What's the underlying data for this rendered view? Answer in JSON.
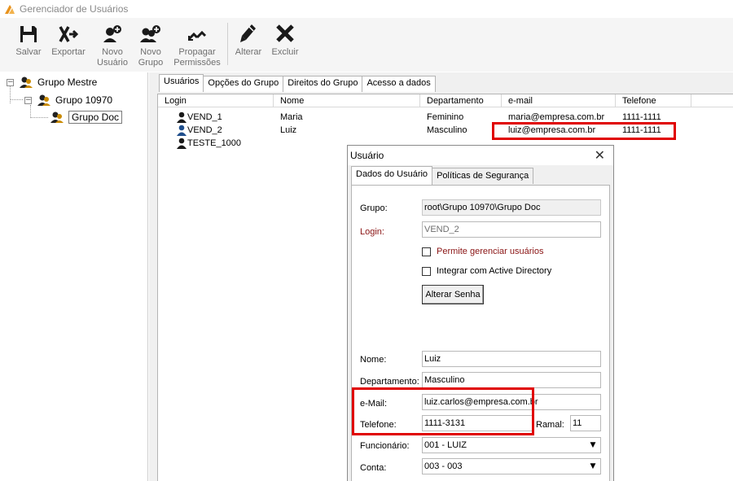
{
  "window": {
    "title": "Gerenciador de Usuários"
  },
  "toolbar": {
    "items": [
      {
        "label": "Salvar",
        "icon": "save-icon"
      },
      {
        "label": "Exportar",
        "icon": "export-icon"
      },
      {
        "label": "Novo\nUsuário",
        "icon": "new-user-icon"
      },
      {
        "label": "Novo\nGrupo",
        "icon": "new-group-icon"
      },
      {
        "label": "Propagar\nPermissões",
        "icon": "propagate-icon"
      },
      {
        "label": "Alterar",
        "icon": "edit-pencil-icon"
      },
      {
        "label": "Excluir",
        "icon": "delete-x-icon"
      }
    ]
  },
  "tree": {
    "nodes": [
      {
        "label": "Grupo Mestre",
        "expander": "−"
      },
      {
        "label": "Grupo 10970",
        "expander": "−"
      },
      {
        "label": "Grupo Doc"
      }
    ]
  },
  "tabs": [
    "Usuários",
    "Opções do Grupo",
    "Direitos do Grupo",
    "Acesso a dados"
  ],
  "list": {
    "columns": [
      "Login",
      "Nome",
      "Departamento",
      "e-mail",
      "Telefone"
    ],
    "rows": [
      {
        "login": "VEND_1",
        "nome": "Maria",
        "departamento": "Feminino",
        "email": "maria@empresa.com.br",
        "telefone": "1111-1111",
        "icon_color": "#1a1a1a"
      },
      {
        "login": "VEND_2",
        "nome": "Luiz",
        "departamento": "Masculino",
        "email": "luiz@empresa.com.br",
        "telefone": "1111-1111",
        "icon_color": "#1f4e8c"
      },
      {
        "login": "TESTE_1000",
        "nome": "",
        "departamento": "",
        "email": "",
        "telefone": "",
        "icon_color": "#1a1a1a"
      }
    ]
  },
  "dialog": {
    "title": "Usuário",
    "close": "✕",
    "tabs": [
      "Dados do Usuário",
      "Políticas de Segurança"
    ],
    "grupo_label": "Grupo:",
    "grupo_value": "root\\Grupo 10970\\Grupo Doc",
    "login_label": "Login:",
    "login_value": "VEND_2",
    "chk_gerenciar": "Permite gerenciar usuários",
    "chk_ad": "Integrar com Active Directory",
    "alterar_senha": "Alterar Senha",
    "nome_label": "Nome:",
    "nome_value": "Luiz",
    "departamento_label": "Departamento:",
    "departamento_value": "Masculino",
    "email_label": "e-Mail:",
    "email_value": "luiz.carlos@empresa.com.br",
    "telefone_label": "Telefone:",
    "telefone_value": "1111-3131",
    "ramal_label": "Ramal:",
    "ramal_value": "11",
    "funcionario_label": "Funcionário:",
    "funcionario_value": "001 - LUIZ",
    "conta_label": "Conta:",
    "conta_value": "003 - 003",
    "dropdown_arrow": "▼"
  },
  "colors": {
    "highlight": "#e00000",
    "accent_orange": "#e8931e"
  }
}
